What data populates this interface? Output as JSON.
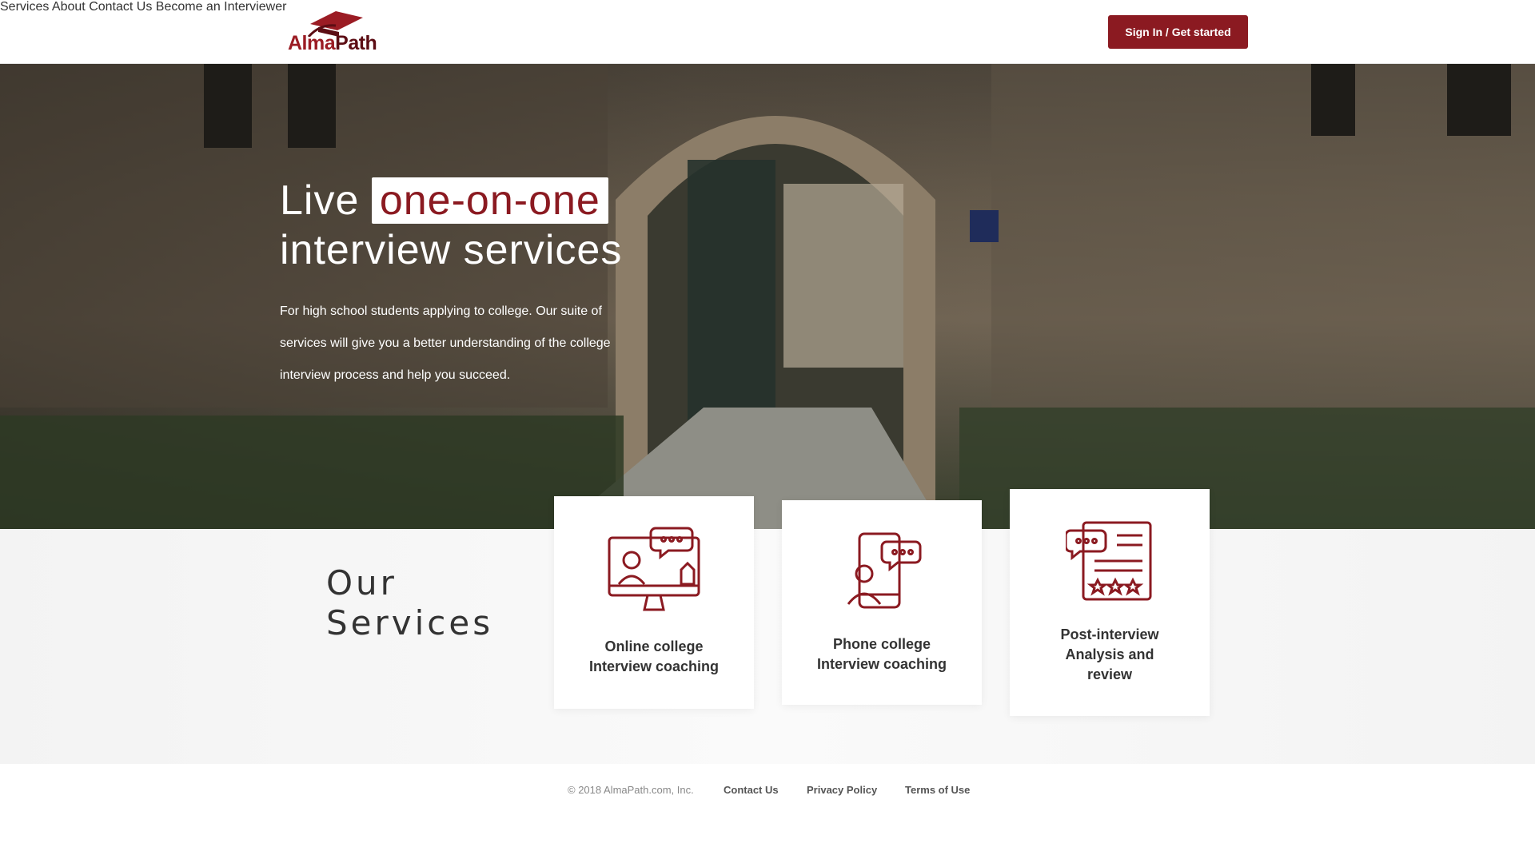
{
  "brand": {
    "part1": "Alma",
    "part2": "Path",
    "accent": "#8b1a21"
  },
  "nav": {
    "services": "Services",
    "about": "About",
    "contact": "Contact Us",
    "become": "Become an Interviewer",
    "cta": "Sign In / Get started"
  },
  "hero": {
    "title_prefix": "Live ",
    "title_highlight": "one-on-one",
    "title_line2": "interview services",
    "subtitle": "For high school students applying to college. Our suite of services will give you a better understanding of the college interview process and help you succeed."
  },
  "services": {
    "heading_line1": "Our",
    "heading_line2": "Services",
    "cards": [
      {
        "icon": "online-coaching-icon",
        "line1": "Online college",
        "line2": "Interview coaching"
      },
      {
        "icon": "phone-coaching-icon",
        "line1": "Phone college",
        "line2": "Interview coaching"
      },
      {
        "icon": "post-interview-review-icon",
        "line1": "Post-interview",
        "line2": "Analysis and",
        "line3": "review"
      }
    ]
  },
  "footer": {
    "copyright": "© 2018 AlmaPath.com, Inc.",
    "contact": "Contact Us",
    "privacy": "Privacy Policy",
    "terms": "Terms of Use"
  }
}
